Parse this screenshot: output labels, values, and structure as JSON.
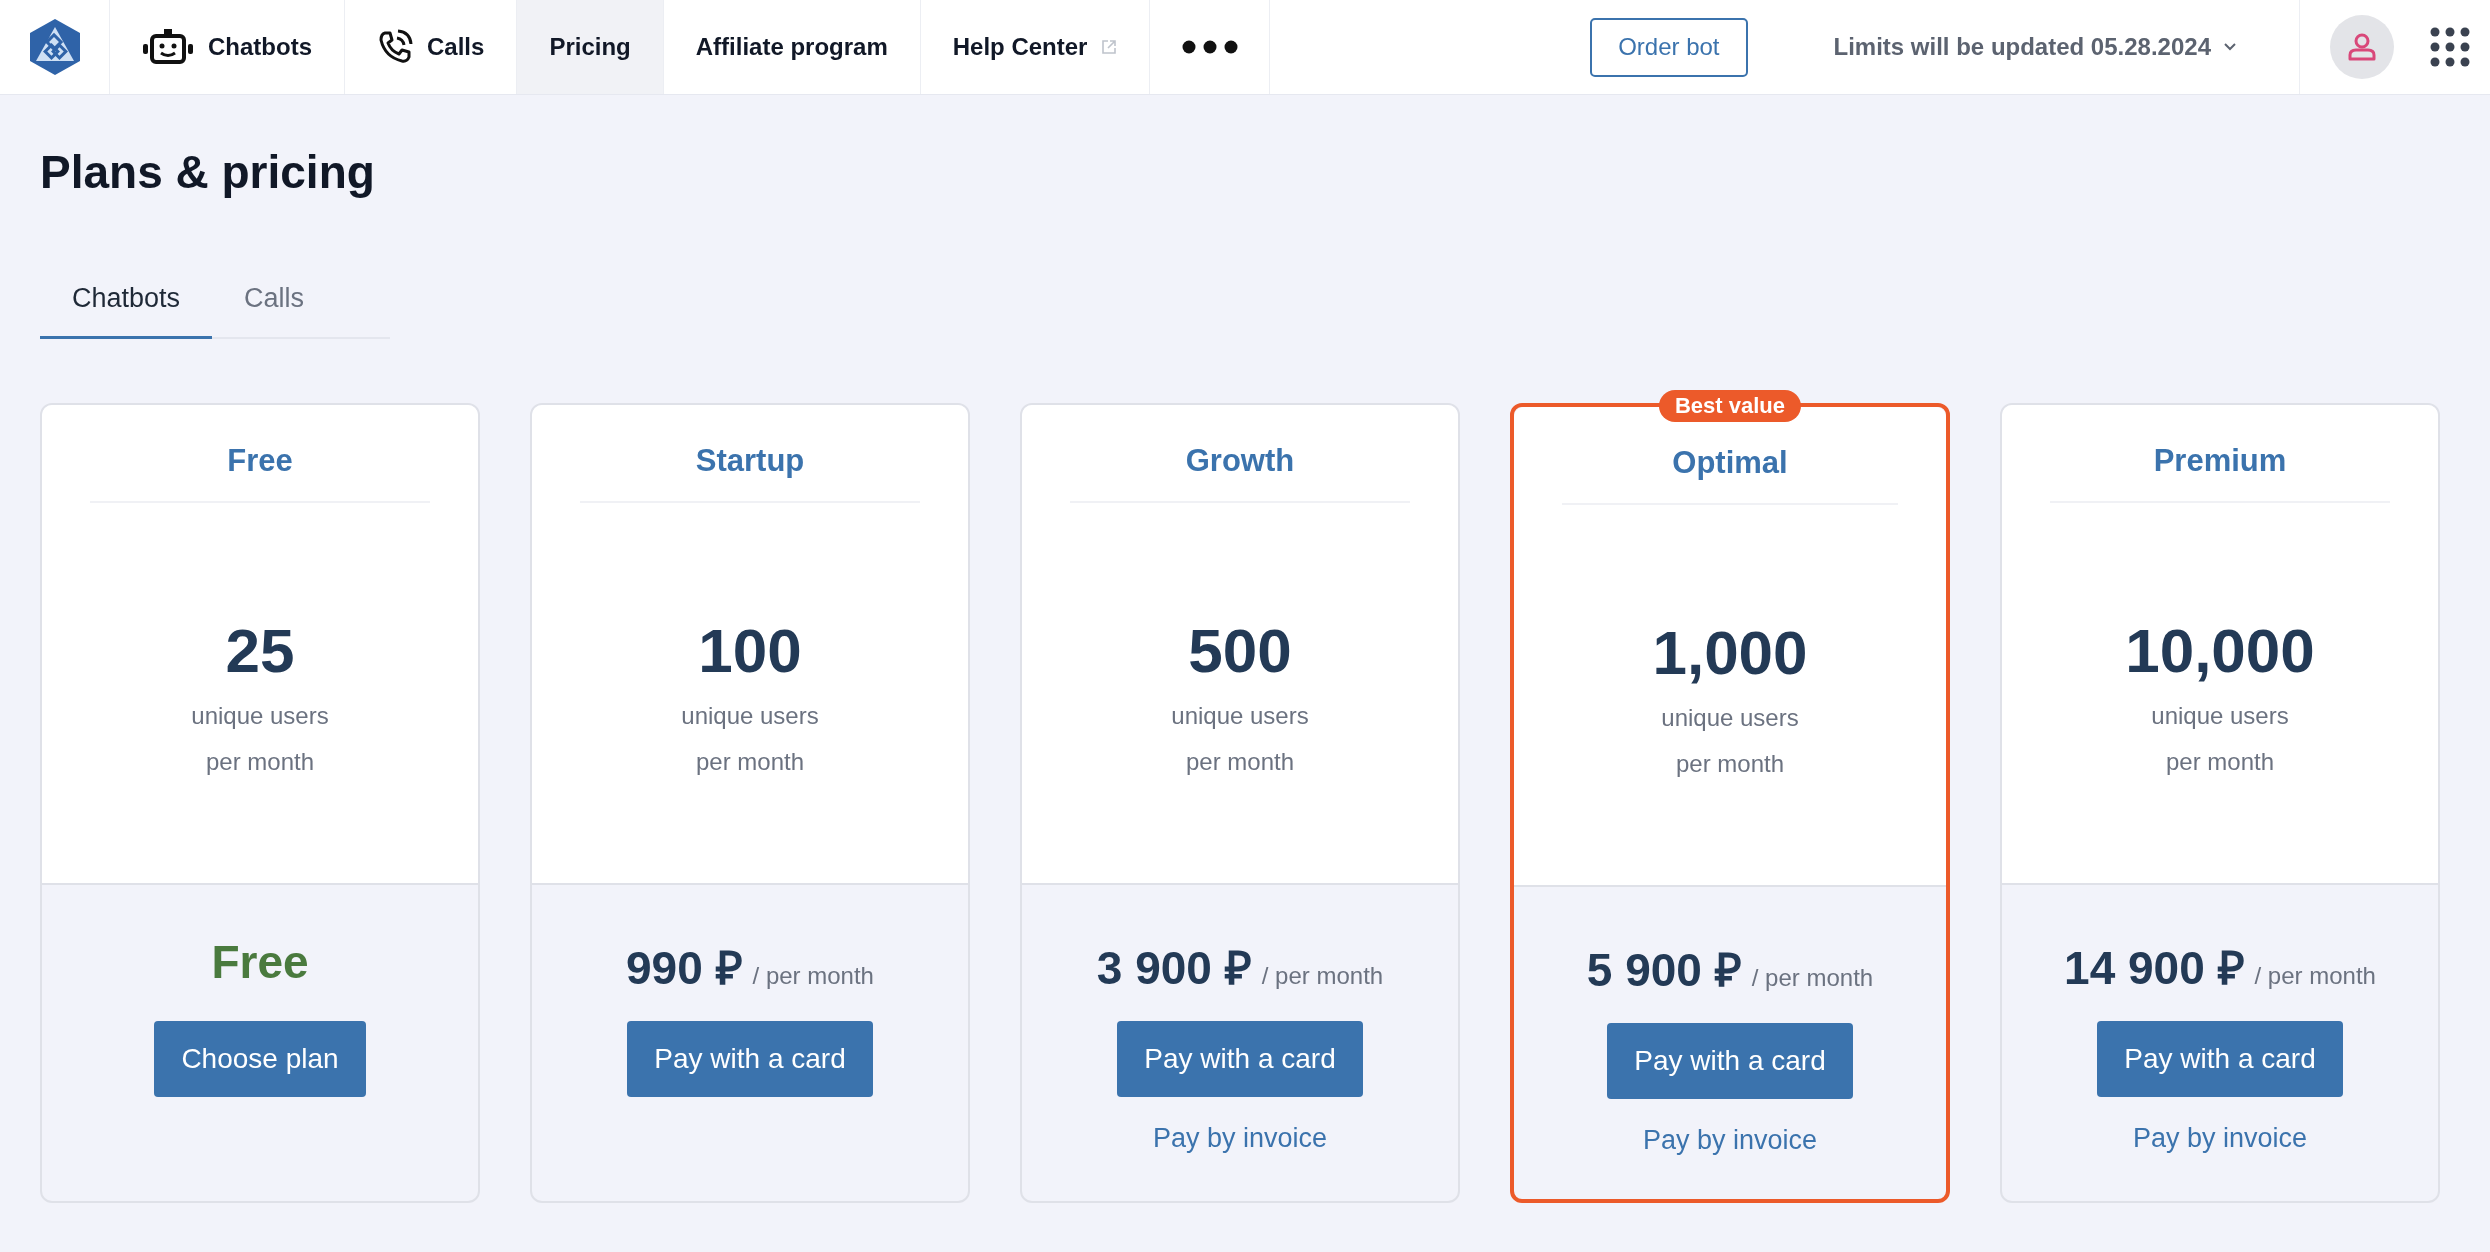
{
  "nav": {
    "items": [
      {
        "label": "Chatbots",
        "selected": false,
        "kind": "bot"
      },
      {
        "label": "Calls",
        "selected": false,
        "kind": "phone"
      },
      {
        "label": "Pricing",
        "selected": true,
        "kind": "plain"
      },
      {
        "label": "Affiliate program",
        "selected": false,
        "kind": "plain"
      },
      {
        "label": "Help Center",
        "selected": false,
        "kind": "external"
      }
    ],
    "order_button": "Order bot",
    "limits": "Limits will be updated 05.28.2024"
  },
  "page_title": "Plans & pricing",
  "tabs": [
    {
      "label": "Chatbots",
      "selected": true
    },
    {
      "label": "Calls",
      "selected": false
    }
  ],
  "plans": [
    {
      "name": "Free",
      "users": "25",
      "users_label": "unique users",
      "period_label": "per month",
      "kind": "free",
      "price": "Free",
      "button": "Choose plan",
      "featured": false
    },
    {
      "name": "Startup",
      "users": "100",
      "users_label": "unique users",
      "period_label": "per month",
      "kind": "paid",
      "price": "990 ₽",
      "price_period": "/ per month",
      "button": "Pay with a card",
      "featured": false
    },
    {
      "name": "Growth",
      "users": "500",
      "users_label": "unique users",
      "period_label": "per month",
      "kind": "paid",
      "price": "3 900 ₽",
      "price_period": "/ per month",
      "button": "Pay with a card",
      "invoice_link": "Pay by invoice",
      "featured": false
    },
    {
      "name": "Optimal",
      "users": "1,000",
      "users_label": "unique users",
      "period_label": "per month",
      "kind": "paid",
      "price": "5 900 ₽",
      "price_period": "/ per month",
      "button": "Pay with a card",
      "invoice_link": "Pay by invoice",
      "featured": true,
      "badge": "Best value"
    },
    {
      "name": "Premium",
      "users": "10,000",
      "users_label": "unique users",
      "period_label": "per month",
      "kind": "paid",
      "price": "14 900 ₽",
      "price_period": "/ per month",
      "button": "Pay with a card",
      "invoice_link": "Pay by invoice",
      "featured": false
    }
  ]
}
